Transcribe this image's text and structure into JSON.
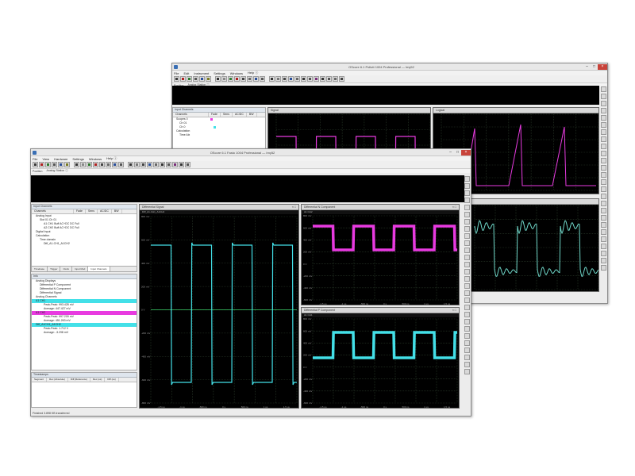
{
  "back_window": {
    "title": "OScore 6.1 Pollutt 1004 Professional — Imy52",
    "menu": [
      "File",
      "Edit",
      "Instrument",
      "Settings",
      "Windows",
      "Help ⓘ"
    ],
    "subbar": [
      "Position",
      "Analog Station ⓘ"
    ],
    "input_panel_title": "Input Channels",
    "table_head": [
      "Channels",
      "Fade",
      "Sens",
      "AC/DC",
      "BW"
    ],
    "tree": [
      "Scopes 0",
      "Ch 01",
      "Ch 0",
      "Ch 1",
      "Calculation",
      "Time Aix"
    ],
    "scope1": {
      "title": "Signal",
      "sub": ""
    },
    "scope2": {
      "title": "Logical",
      "sub": ""
    }
  },
  "front_window": {
    "title": "OScore 6.1 Fasto 1004 Professional — Imy52",
    "menu": [
      "File",
      "View",
      "Hardware",
      "Settings",
      "Windows",
      "Help ⓘ"
    ],
    "subbar": [
      "Position",
      "Analog Station ⓘ"
    ],
    "input_panel": {
      "title": "Input Channels",
      "head": [
        "Channels",
        "Fade",
        "Sens",
        "AC/DC",
        "BW"
      ],
      "rows": [
        {
          "label": "Analog Input",
          "indent": 1
        },
        {
          "label": "Slot 01  Ch 01",
          "indent": 2
        },
        {
          "label": "A1 CH1   Buff   AC+DC   DC   Full",
          "indent": 3
        },
        {
          "label": "A2 CH2   Buff   AC+DC   DC   Full",
          "indent": 3
        },
        {
          "label": "Digital Input",
          "indent": 1
        },
        {
          "label": "Calculation",
          "indent": 1
        },
        {
          "label": "Time domain",
          "indent": 2
        },
        {
          "label": "Diff_A1-CH1_A1CH2",
          "indent": 3
        }
      ],
      "tabs": [
        "Timebase",
        "Trigger",
        "Clock",
        "Input Mod",
        "Input Channels"
      ]
    },
    "info_panel": {
      "title": "Info",
      "rows": [
        {
          "label": "Analog Displays",
          "indent": 1,
          "hl": ""
        },
        {
          "label": "Differential P Component",
          "indent": 2,
          "hl": ""
        },
        {
          "label": "Differential N Component",
          "indent": 2,
          "hl": ""
        },
        {
          "label": "Differential Signal",
          "indent": 2,
          "hl": ""
        },
        {
          "label": "Analog Channels",
          "indent": 1,
          "hl": ""
        },
        {
          "label": "A1 CH1",
          "indent": 1,
          "hl": "cyan"
        },
        {
          "label": "Peak-Peak: 993.428 mV",
          "indent": 3,
          "hl": ""
        },
        {
          "label": "Average: 447.427 mV",
          "indent": 3,
          "hl": ""
        },
        {
          "label": "A1 CH2",
          "indent": 1,
          "hl": "mag"
        },
        {
          "label": "Peak-Peak: 997.209 mV",
          "indent": 3,
          "hl": ""
        },
        {
          "label": "Average: 451.263 mV",
          "indent": 3,
          "hl": ""
        },
        {
          "label": "Diff_A1CH1_A1CH2",
          "indent": 1,
          "hl": "cyan"
        },
        {
          "label": "Peak-Peak: 1.712 V",
          "indent": 3,
          "hl": ""
        },
        {
          "label": "Average: -3.298 mV",
          "indent": 3,
          "hl": ""
        }
      ]
    },
    "timestamps_panel": {
      "title": "Timestamps",
      "head": [
        "Segment",
        "Rec (Absolute)",
        "Diff (Reference)",
        "Rec (us)",
        "Diff (us)"
      ]
    },
    "status": "Finished   3.898 KB transferred",
    "scopes": [
      {
        "title": "Differential Signal",
        "sub": "Diff_A1-CH1_A1CH2",
        "y_ticks": [
          "800 mV",
          "600 mV",
          "400 mV",
          "200 mV",
          "0 V",
          "-200 mV",
          "-400 mV",
          "-600 mV",
          "-800 mV"
        ],
        "x_ticks": [
          "-1.5 us",
          "-1 us",
          "-500 ns",
          "0 s",
          "500 ns",
          "1 us",
          "1.5 us"
        ]
      },
      {
        "title": "Differential N Component",
        "sub": "A1 CH2",
        "y_ticks": [
          "800 mV",
          "600 mV",
          "400 mV",
          "200 mV",
          "0 V",
          "-200 mV",
          "-400 mV",
          "-600 mV"
        ],
        "x_ticks": [
          "-1.5 us",
          "-1 us",
          "-500 ns",
          "0 s",
          "500 ns",
          "1 us",
          "1.5 us"
        ]
      },
      {
        "title": "Differential P Component",
        "sub": "A1 CH1",
        "y_ticks": [
          "800 mV",
          "600 mV",
          "400 mV",
          "200 mV",
          "0 V",
          "-200 mV",
          "-400 mV",
          "-600 mV"
        ],
        "x_ticks": [
          "-1.5 us",
          "-1 us",
          "-500 ns",
          "0 s",
          "500 ns",
          "1 us",
          "1.5 us"
        ]
      }
    ]
  },
  "colors": {
    "cyan": "#43e0e8",
    "magenta": "#e83ae0",
    "grid": "#2a3a2a",
    "screen": "#000000"
  }
}
